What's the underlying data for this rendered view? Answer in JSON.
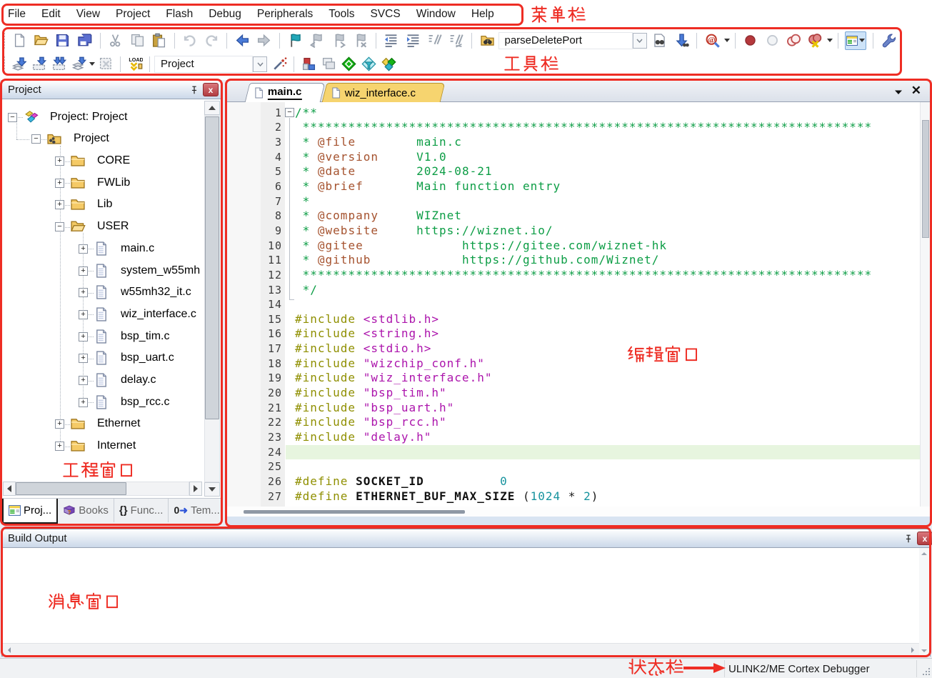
{
  "menu": {
    "items": [
      "File",
      "Edit",
      "View",
      "Project",
      "Flash",
      "Debug",
      "Peripherals",
      "Tools",
      "SVCS",
      "Window",
      "Help"
    ]
  },
  "toolbar": {
    "row1": [
      "new",
      "open",
      "save",
      "saveall",
      "|",
      "cut",
      "copy",
      "paste",
      "|",
      "undo",
      "redo",
      "|",
      "back",
      "fwd",
      "|",
      "flag",
      "flagprev",
      "flagnext",
      "flagclear",
      "|",
      "indentl",
      "indentr",
      "comment",
      "uncomment",
      "|",
      "findfolder",
      {
        "type": "field",
        "value": "parseDeletePort",
        "width": 188,
        "name": "find-combobox"
      },
      {
        "type": "chev"
      },
      "finddoc",
      "findnext",
      "|",
      "debugq",
      {
        "type": "caret"
      },
      "|",
      "bp",
      "bpoff",
      "bpall",
      "bpkill",
      {
        "type": "caret"
      },
      "|",
      {
        "type": "winbtn"
      },
      "|",
      "wrench"
    ],
    "row2": [
      "translate",
      "build",
      "rebuild",
      "batch",
      {
        "type": "caret"
      },
      "stop",
      "|",
      "load",
      "|",
      {
        "type": "field",
        "value": "Project",
        "width": 138,
        "name": "target-combobox"
      },
      {
        "type": "chev"
      },
      "wand",
      "|",
      "targetopt",
      "winstack",
      "diagreen",
      "funnel",
      "diamulti"
    ],
    "find_value": "parseDeletePort",
    "target_value": "Project"
  },
  "project_panel": {
    "title": "Project",
    "tree": [
      {
        "label": "Project: Project",
        "lvl": 0,
        "exp": "-",
        "icon": "root"
      },
      {
        "label": "Project",
        "lvl": 1,
        "exp": "-",
        "icon": "target"
      },
      {
        "label": "CORE",
        "lvl": 2,
        "exp": "+",
        "icon": "folder"
      },
      {
        "label": "FWLib",
        "lvl": 2,
        "exp": "+",
        "icon": "folder"
      },
      {
        "label": "Lib",
        "lvl": 2,
        "exp": "+",
        "icon": "folder"
      },
      {
        "label": "USER",
        "lvl": 2,
        "exp": "-",
        "icon": "folderopen"
      },
      {
        "label": "main.c",
        "lvl": 3,
        "exp": "+",
        "icon": "file"
      },
      {
        "label": "system_w55mh",
        "lvl": 3,
        "exp": "+",
        "icon": "file"
      },
      {
        "label": "w55mh32_it.c",
        "lvl": 3,
        "exp": "+",
        "icon": "file"
      },
      {
        "label": "wiz_interface.c",
        "lvl": 3,
        "exp": "+",
        "icon": "file"
      },
      {
        "label": "bsp_tim.c",
        "lvl": 3,
        "exp": "+",
        "icon": "file"
      },
      {
        "label": "bsp_uart.c",
        "lvl": 3,
        "exp": "+",
        "icon": "file"
      },
      {
        "label": "delay.c",
        "lvl": 3,
        "exp": "+",
        "icon": "file"
      },
      {
        "label": "bsp_rcc.c",
        "lvl": 3,
        "exp": "+",
        "icon": "file"
      },
      {
        "label": "Ethernet",
        "lvl": 2,
        "exp": "+",
        "icon": "folder"
      },
      {
        "label": "Internet",
        "lvl": 2,
        "exp": "+",
        "icon": "folder"
      }
    ],
    "tabs": [
      {
        "label": "Proj...",
        "icon": "projtab",
        "active": true
      },
      {
        "label": "Books",
        "icon": "bookstab",
        "active": false
      },
      {
        "label": "Func...",
        "icon": "functab",
        "active": false
      },
      {
        "label": "Tem...",
        "icon": "temtab",
        "active": false
      }
    ]
  },
  "editor": {
    "tabs": [
      {
        "label": "main.c",
        "active": true
      },
      {
        "label": "wiz_interface.c",
        "active": false
      }
    ],
    "highlight_line": 24,
    "lines": [
      [
        [
          "/**",
          "cm"
        ]
      ],
      [
        [
          " ***************************************************************************",
          "cm"
        ]
      ],
      [
        [
          " * ",
          "cm"
        ],
        [
          "@file",
          "tag"
        ],
        [
          "        ",
          "cm"
        ],
        [
          "main.c",
          "cm"
        ]
      ],
      [
        [
          " * ",
          "cm"
        ],
        [
          "@version",
          "tag"
        ],
        [
          "     ",
          "cm"
        ],
        [
          "V1.0",
          "cm"
        ]
      ],
      [
        [
          " * ",
          "cm"
        ],
        [
          "@date",
          "tag"
        ],
        [
          "        ",
          "cm"
        ],
        [
          "2024-08-21",
          "cm"
        ]
      ],
      [
        [
          " * ",
          "cm"
        ],
        [
          "@brief",
          "tag"
        ],
        [
          "       ",
          "cm"
        ],
        [
          "Main function entry",
          "cm"
        ]
      ],
      [
        [
          " *",
          "cm"
        ]
      ],
      [
        [
          " * ",
          "cm"
        ],
        [
          "@company",
          "tag"
        ],
        [
          "     ",
          "cm"
        ],
        [
          "WIZnet",
          "cm"
        ]
      ],
      [
        [
          " * ",
          "cm"
        ],
        [
          "@website",
          "tag"
        ],
        [
          "     ",
          "cm"
        ],
        [
          "https://wiznet.io/",
          "cm"
        ]
      ],
      [
        [
          " * ",
          "cm"
        ],
        [
          "@gitee",
          "tag"
        ],
        [
          "             ",
          "cm"
        ],
        [
          "https://gitee.com/wiznet-hk",
          "cm"
        ]
      ],
      [
        [
          " * ",
          "cm"
        ],
        [
          "@github",
          "tag"
        ],
        [
          "            ",
          "cm"
        ],
        [
          "https://github.com/Wiznet/",
          "cm"
        ]
      ],
      [
        [
          " ***************************************************************************",
          "cm"
        ]
      ],
      [
        [
          " */",
          "cm"
        ]
      ],
      [],
      [
        [
          "#include",
          "pp"
        ],
        [
          " ",
          "pl"
        ],
        [
          "<stdlib.h>",
          "str"
        ]
      ],
      [
        [
          "#include",
          "pp"
        ],
        [
          " ",
          "pl"
        ],
        [
          "<string.h>",
          "str"
        ]
      ],
      [
        [
          "#include",
          "pp"
        ],
        [
          " ",
          "pl"
        ],
        [
          "<stdio.h>",
          "str"
        ]
      ],
      [
        [
          "#include",
          "pp"
        ],
        [
          " ",
          "pl"
        ],
        [
          "\"wizchip_conf.h\"",
          "str"
        ]
      ],
      [
        [
          "#include",
          "pp"
        ],
        [
          " ",
          "pl"
        ],
        [
          "\"wiz_interface.h\"",
          "str"
        ]
      ],
      [
        [
          "#include",
          "pp"
        ],
        [
          " ",
          "pl"
        ],
        [
          "\"bsp_tim.h\"",
          "str"
        ]
      ],
      [
        [
          "#include",
          "pp"
        ],
        [
          " ",
          "pl"
        ],
        [
          "\"bsp_uart.h\"",
          "str"
        ]
      ],
      [
        [
          "#include",
          "pp"
        ],
        [
          " ",
          "pl"
        ],
        [
          "\"bsp_rcc.h\"",
          "str"
        ]
      ],
      [
        [
          "#include",
          "pp"
        ],
        [
          " ",
          "pl"
        ],
        [
          "\"delay.h\"",
          "str"
        ]
      ],
      [],
      [],
      [
        [
          "#define",
          "pp"
        ],
        [
          " ",
          "pl"
        ],
        [
          "SOCKET_ID",
          "def"
        ],
        [
          "          ",
          "pl"
        ],
        [
          "0",
          "num"
        ]
      ],
      [
        [
          "#define",
          "pp"
        ],
        [
          " ",
          "pl"
        ],
        [
          "ETHERNET_BUF_MAX_SIZE",
          "def"
        ],
        [
          " (",
          "pl"
        ],
        [
          "1024",
          "num"
        ],
        [
          " * ",
          "pl"
        ],
        [
          "2",
          "num"
        ],
        [
          ")",
          "pl"
        ]
      ]
    ]
  },
  "build_output": {
    "title": "Build Output"
  },
  "status_bar": {
    "debugger": "ULINK2/ME Cortex Debugger"
  },
  "annotations": {
    "menu": "菜单栏",
    "toolbar": "工具栏",
    "project": "工程窗口",
    "editor": "编辑窗口",
    "message": "消息窗口",
    "status": "状态栏",
    "color": "#ee2d24"
  }
}
